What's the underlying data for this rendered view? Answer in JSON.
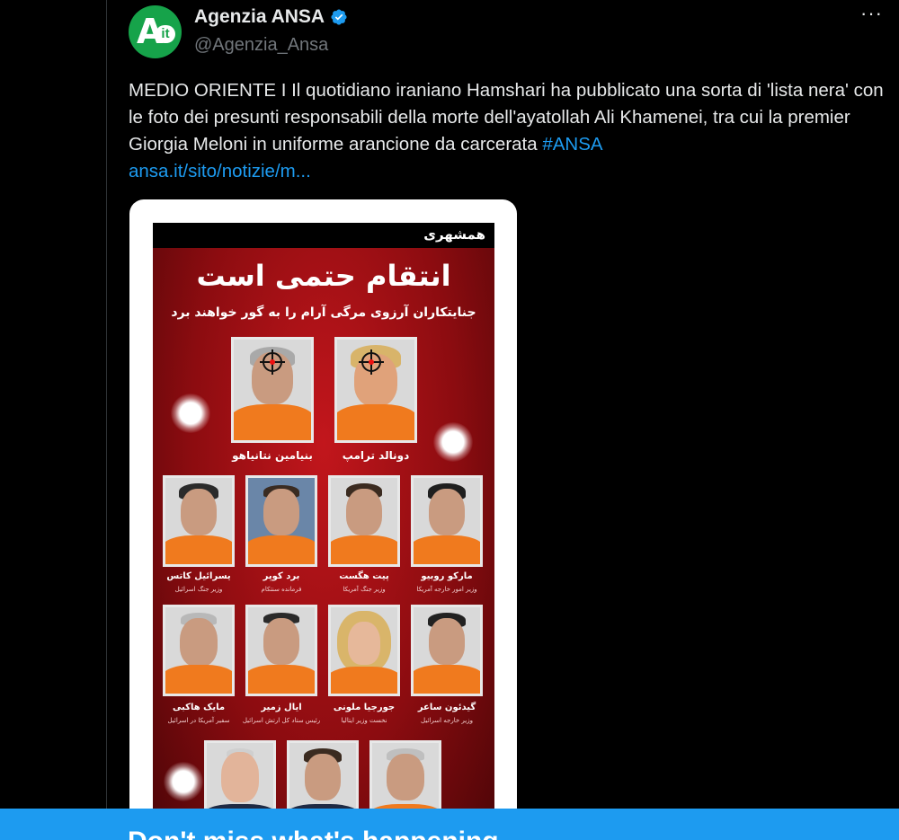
{
  "account": {
    "display_name": "Agenzia ANSA",
    "handle": "@Agenzia_Ansa",
    "avatar_logo": "A",
    "avatar_logo_suffix": "it",
    "verified": true
  },
  "more_menu": "···",
  "tweet": {
    "text": "MEDIO ORIENTE I Il quotidiano iraniano Hamshari ha pubblicato una sorta di 'lista nera' con le foto dei presunti responsabili della morte dell'ayatollah Ali Khamenei, tra cui la premier Giorgia Meloni in uniforme arancione da carcerata ",
    "hashtag": "#ANSA",
    "link": "ansa.it/sito/notizie/m..."
  },
  "poster": {
    "masthead": "همشهری",
    "headline": "انتقام حتمی است",
    "subhead": "جنایتکاران آرزوی مرگی آرام را به گور خواهند برد",
    "row1": [
      {
        "name": "بنیامین نتانیاهو"
      },
      {
        "name": "دونالد ترامپ"
      }
    ],
    "row2": [
      {
        "name": "یسرائیل کاتس",
        "role": "وزیر جنگ اسرائیل"
      },
      {
        "name": "برد کوپر",
        "role": "فرمانده سنتکام"
      },
      {
        "name": "پیت هگست",
        "role": "وزیر جنگ آمریکا"
      },
      {
        "name": "مارکو روبیو",
        "role": "وزیر امور خارجه آمریکا"
      }
    ],
    "row3": [
      {
        "name": "مایک هاکبی",
        "role": "سفیر آمریکا در اسرائیل"
      },
      {
        "name": "ایال زمیر",
        "role": "رئیس ستاد کل ارتش اسرائیل"
      },
      {
        "name": "جورجیا ملونی",
        "role": "نخست وزیر ایتالیا"
      },
      {
        "name": "گیدئون ساعر",
        "role": "وزیر خارجه اسرائیل"
      }
    ]
  },
  "banner": {
    "text": "Don't miss what's happening"
  },
  "colors": {
    "link": "#1d9bf0",
    "background": "#000000",
    "text": "#e7e9ea",
    "muted": "#71767b",
    "verified": "#1d9bf0"
  }
}
